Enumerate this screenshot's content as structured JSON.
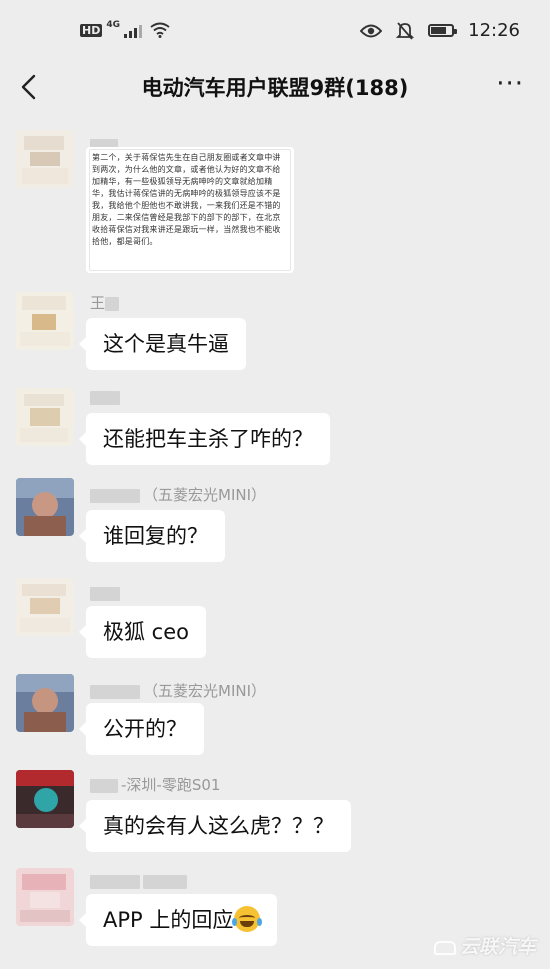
{
  "status_bar": {
    "hd": "HD",
    "network": "4G",
    "time": "12:26"
  },
  "header": {
    "title": "电动汽车用户联盟9群(188)",
    "more": "···"
  },
  "document_image": {
    "text": "第二个，关于蒋保信先生在自己朋友圈或者文章中讲到两次，为什么他的文章，或者他认为好的文章不给加精华，有一些极狐领导无病呻吟的文章就给加精华，我估计蒋保信讲的无病呻吟的极狐领导应该不是我，我给他个胆他也不敢讲我，一来我们还是不错的朋友，二来保信曾经是我部下的部下的部下，在北京收拾蒋保信对我来讲还是跟玩一样，当然我也不能收拾他，都是哥们。"
  },
  "messages": [
    {
      "sender_suffix": "",
      "text": "这个是真牛逼"
    },
    {
      "sender_suffix": "",
      "text": "还能把车主杀了咋的？"
    },
    {
      "sender_suffix": "（五菱宏光MINI）",
      "text": "谁回复的？"
    },
    {
      "sender_suffix": "",
      "text": "极狐 ceo"
    },
    {
      "sender_suffix": "（五菱宏光MINI）",
      "text": "公开的？"
    },
    {
      "sender_suffix": "-深圳-零跑S01",
      "text": "真的会有人这么虎？？？"
    },
    {
      "sender_suffix": "",
      "text": "APP 上的回应"
    }
  ],
  "watermark": "云联汽车",
  "icons": [
    "back-arrow-icon",
    "more-icon",
    "signal-icon",
    "wifi-icon",
    "eye-icon",
    "bell-off-icon",
    "battery-icon",
    "laughing-tears-emoji-icon"
  ]
}
